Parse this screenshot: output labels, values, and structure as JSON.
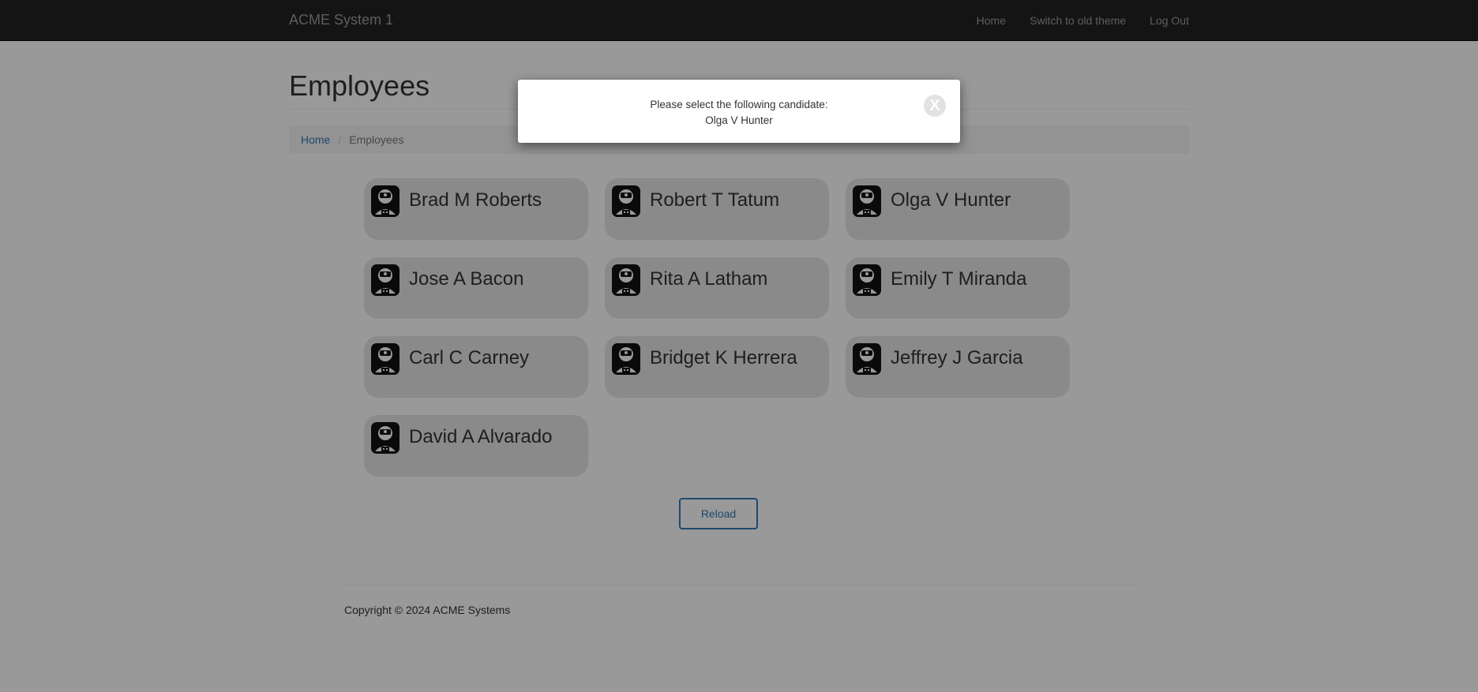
{
  "navbar": {
    "brand": "ACME System 1",
    "links": [
      "Home",
      "Switch to old theme",
      "Log Out"
    ]
  },
  "page": {
    "title": "Employees"
  },
  "breadcrumb": {
    "home": "Home",
    "current": "Employees"
  },
  "employees": [
    "Brad M Roberts",
    "Robert T Tatum",
    "Olga V Hunter",
    "Jose A Bacon",
    "Rita A Latham",
    "Emily T Miranda",
    "Carl C Carney",
    "Bridget K Herrera",
    "Jeffrey J Garcia",
    "David A Alvarado"
  ],
  "reload_label": "Reload",
  "footer": {
    "copyright": "Copyright © 2024 ACME Systems"
  },
  "modal": {
    "line1": "Please select the following candidate:",
    "line2": "Olga V Hunter",
    "close_glyph": "X"
  },
  "icons": {
    "employee": "employee-avatar-icon",
    "close": "close-icon"
  }
}
